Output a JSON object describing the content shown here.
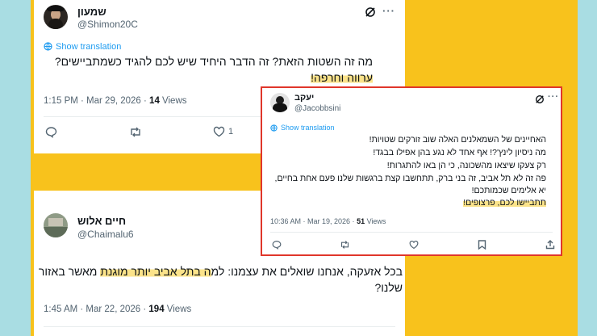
{
  "tweet1": {
    "name": "שמעון",
    "handle": "@Shimon20C",
    "translate": "Show translation",
    "line1": "מה זה השטות הזאת? זה הדבר היחיד שיש לכם להגיד כשמתביישים?",
    "line2": "ערווה וחרפה!",
    "time": "1:15 PM · Mar 29, 2026 · ",
    "views_count": "14",
    "views_label": " Views",
    "likes": "1"
  },
  "tweet2": {
    "name": "חיים אלוש",
    "handle": "@Chaimalu6",
    "line1_a": "בכל אזעקה, אנחנו שואלים את עצמנו: למ",
    "line1_hl": "ה בתל אביב יותר מוגנת",
    "line1_b": " מאשר באזור",
    "line2": "שלנו?",
    "time": "1:45 AM · Mar 22, 2026 · ",
    "views_count": "194",
    "views_label": " Views"
  },
  "tweet3": {
    "name": "יעקב",
    "handle": "@Jacobbsini",
    "translate": "Show translation",
    "lines": [
      "האחיינים של השמאלנים האלה שוב זורקים שטויות!",
      "מה ניסיון לינץ'?! אף אחד לא נגע בהן אפילו בבגד!",
      "רק צעקו שיצאו מהשכונה, כי הן באו להתגרות!",
      "פה זה לא תל אביב, זה בני ברק, תתחשבו קצת ברגשות שלנו פעם אחת בחיים,",
      "יא אלימים שכמותכם!"
    ],
    "line_hl": "תתביישו לכם, פרצופים!",
    "time": "10:36 AM · Mar 19, 2026 · ",
    "views_count": "51",
    "views_label": " Views"
  },
  "colors": {
    "background": "#f8c21c",
    "edges": "#a9dde3",
    "highlight": "#fbe38a",
    "frame": "#e0362b",
    "link": "#1d9bf0"
  }
}
